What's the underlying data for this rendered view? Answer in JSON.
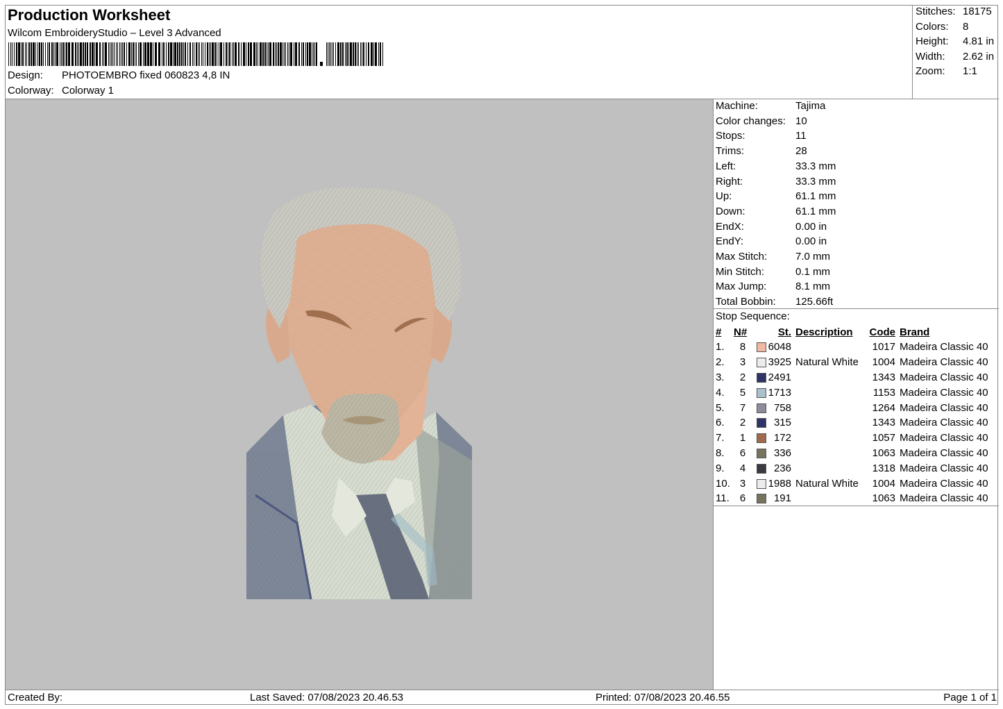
{
  "header": {
    "title": "Production Worksheet",
    "subtitle": "Wilcom EmbroideryStudio – Level 3 Advanced",
    "design_label": "Design:",
    "design_value": "PHOTOEMBRO fixed 060823 4,8 IN",
    "colorway_label": "Colorway:",
    "colorway_value": "Colorway 1"
  },
  "summary": [
    {
      "label": "Stitches:",
      "value": "18175"
    },
    {
      "label": "Colors:",
      "value": "8"
    },
    {
      "label": "Height:",
      "value": "4.81 in"
    },
    {
      "label": "Width:",
      "value": "2.62 in"
    },
    {
      "label": "Zoom:",
      "value": "1:1"
    }
  ],
  "machine_info": [
    {
      "label": "Machine:",
      "value": "Tajima"
    },
    {
      "label": "Color changes:",
      "value": "10"
    },
    {
      "label": "Stops:",
      "value": "11"
    },
    {
      "label": "Trims:",
      "value": "28"
    },
    {
      "label": "Left:",
      "value": "33.3 mm"
    },
    {
      "label": "Right:",
      "value": "33.3 mm"
    },
    {
      "label": "Up:",
      "value": "61.1 mm"
    },
    {
      "label": "Down:",
      "value": "61.1 mm"
    },
    {
      "label": "EndX:",
      "value": "0.00 in"
    },
    {
      "label": "EndY:",
      "value": "0.00 in"
    },
    {
      "label": "Max Stitch:",
      "value": "7.0 mm"
    },
    {
      "label": "Min Stitch:",
      "value": "0.1 mm"
    },
    {
      "label": "Max Jump:",
      "value": "8.1 mm"
    },
    {
      "label": "Total Bobbin:",
      "value": "125.66ft"
    }
  ],
  "stop_sequence": {
    "title": "Stop Sequence:",
    "columns": [
      "#",
      "N#",
      "St.",
      "Description",
      "Code",
      "Brand"
    ],
    "rows": [
      {
        "idx": "1.",
        "n": "8",
        "color": "#f2b8a0",
        "st": "6048",
        "desc": "",
        "code": "1017",
        "brand": "Madeira Classic 40"
      },
      {
        "idx": "2.",
        "n": "3",
        "color": "#ececec",
        "st": "3925",
        "desc": "Natural White",
        "code": "1004",
        "brand": "Madeira Classic 40"
      },
      {
        "idx": "3.",
        "n": "2",
        "color": "#2e3566",
        "st": "2491",
        "desc": "",
        "code": "1343",
        "brand": "Madeira Classic 40"
      },
      {
        "idx": "4.",
        "n": "5",
        "color": "#a9c1cc",
        "st": "1713",
        "desc": "",
        "code": "1153",
        "brand": "Madeira Classic 40"
      },
      {
        "idx": "5.",
        "n": "7",
        "color": "#8f8c9c",
        "st": "758",
        "desc": "",
        "code": "1264",
        "brand": "Madeira Classic 40"
      },
      {
        "idx": "6.",
        "n": "2",
        "color": "#2e3566",
        "st": "315",
        "desc": "",
        "code": "1343",
        "brand": "Madeira Classic 40"
      },
      {
        "idx": "7.",
        "n": "1",
        "color": "#a06a4c",
        "st": "172",
        "desc": "",
        "code": "1057",
        "brand": "Madeira Classic 40"
      },
      {
        "idx": "8.",
        "n": "6",
        "color": "#76745e",
        "st": "336",
        "desc": "",
        "code": "1063",
        "brand": "Madeira Classic 40"
      },
      {
        "idx": "9.",
        "n": "4",
        "color": "#3a3a40",
        "st": "236",
        "desc": "",
        "code": "1318",
        "brand": "Madeira Classic 40"
      },
      {
        "idx": "10.",
        "n": "3",
        "color": "#ececec",
        "st": "1988",
        "desc": "Natural White",
        "code": "1004",
        "brand": "Madeira Classic 40"
      },
      {
        "idx": "11.",
        "n": "6",
        "color": "#76745e",
        "st": "191",
        "desc": "",
        "code": "1063",
        "brand": "Madeira Classic 40"
      }
    ]
  },
  "footer": {
    "created_by": "Created By:",
    "last_saved": "Last Saved: 07/08/2023 20.46.53",
    "printed": "Printed: 07/08/2023 20.46.55",
    "page": "Page 1 of 1"
  },
  "preview": {
    "background": "#c0c0c0",
    "skin": "#e2b396",
    "hair": "#c9c9c1",
    "jacket": "#7d8797",
    "shirt": "#d6dccf",
    "tie": "#687080"
  }
}
